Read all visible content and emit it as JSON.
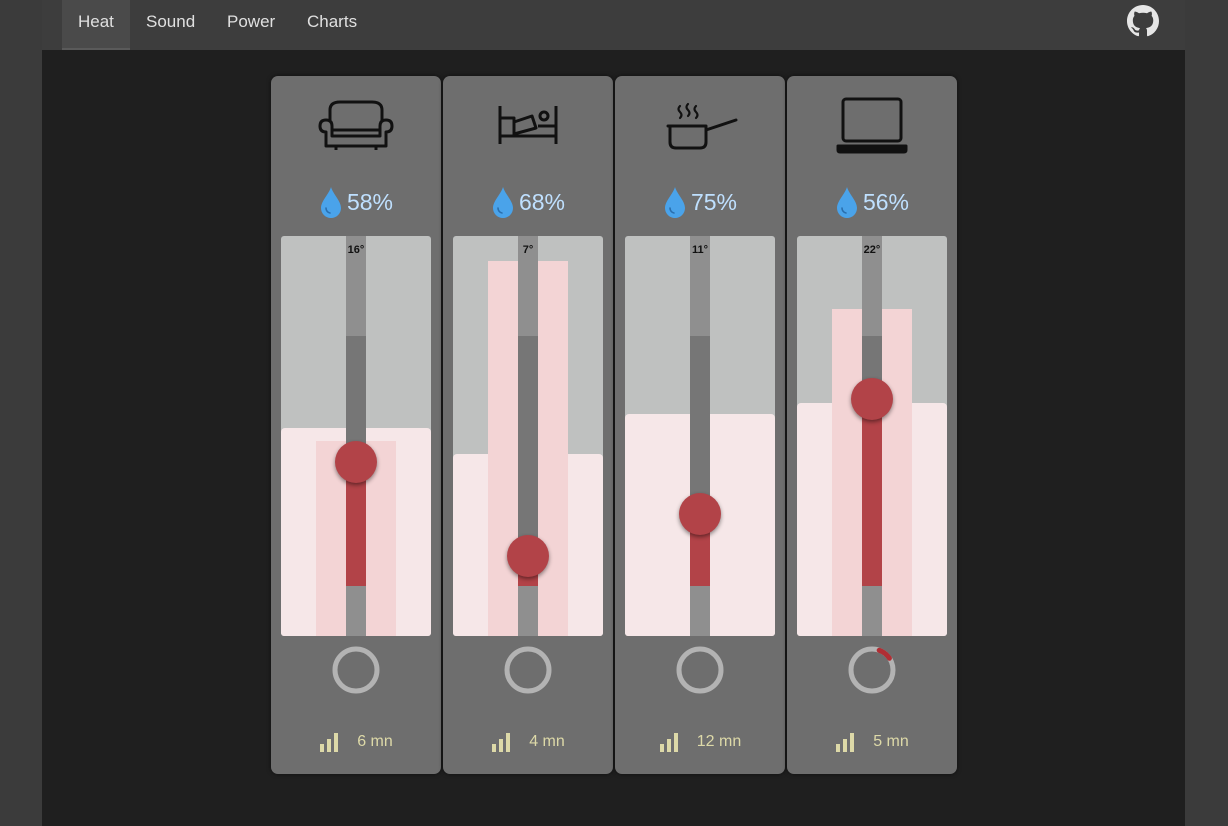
{
  "nav": {
    "tabs": [
      {
        "label": "Heat",
        "active": true
      },
      {
        "label": "Sound",
        "active": false
      },
      {
        "label": "Power",
        "active": false
      },
      {
        "label": "Charts",
        "active": false
      }
    ],
    "github_icon": "github-icon"
  },
  "colors": {
    "page_bg": "#3b3b3b",
    "content_bg": "#1f1f1f",
    "card_bg": "#6e6e6e",
    "accent_red": "#b24348",
    "humidity_blue": "#4aa3ea",
    "footer_text": "#ddd9a8"
  },
  "rooms": [
    {
      "icon": "sofa-icon",
      "humidity": "58%",
      "temperature": "16°",
      "last_update": "6 mn",
      "heating_progress": 0
    },
    {
      "icon": "bed-icon",
      "humidity": "68%",
      "temperature": "7°",
      "last_update": "4 mn",
      "heating_progress": 0
    },
    {
      "icon": "cooking-icon",
      "humidity": "75%",
      "temperature": "11°",
      "last_update": "12 mn",
      "heating_progress": 0
    },
    {
      "icon": "laptop-icon",
      "humidity": "56%",
      "temperature": "22°",
      "last_update": "5 mn",
      "heating_progress": 0.1
    }
  ]
}
